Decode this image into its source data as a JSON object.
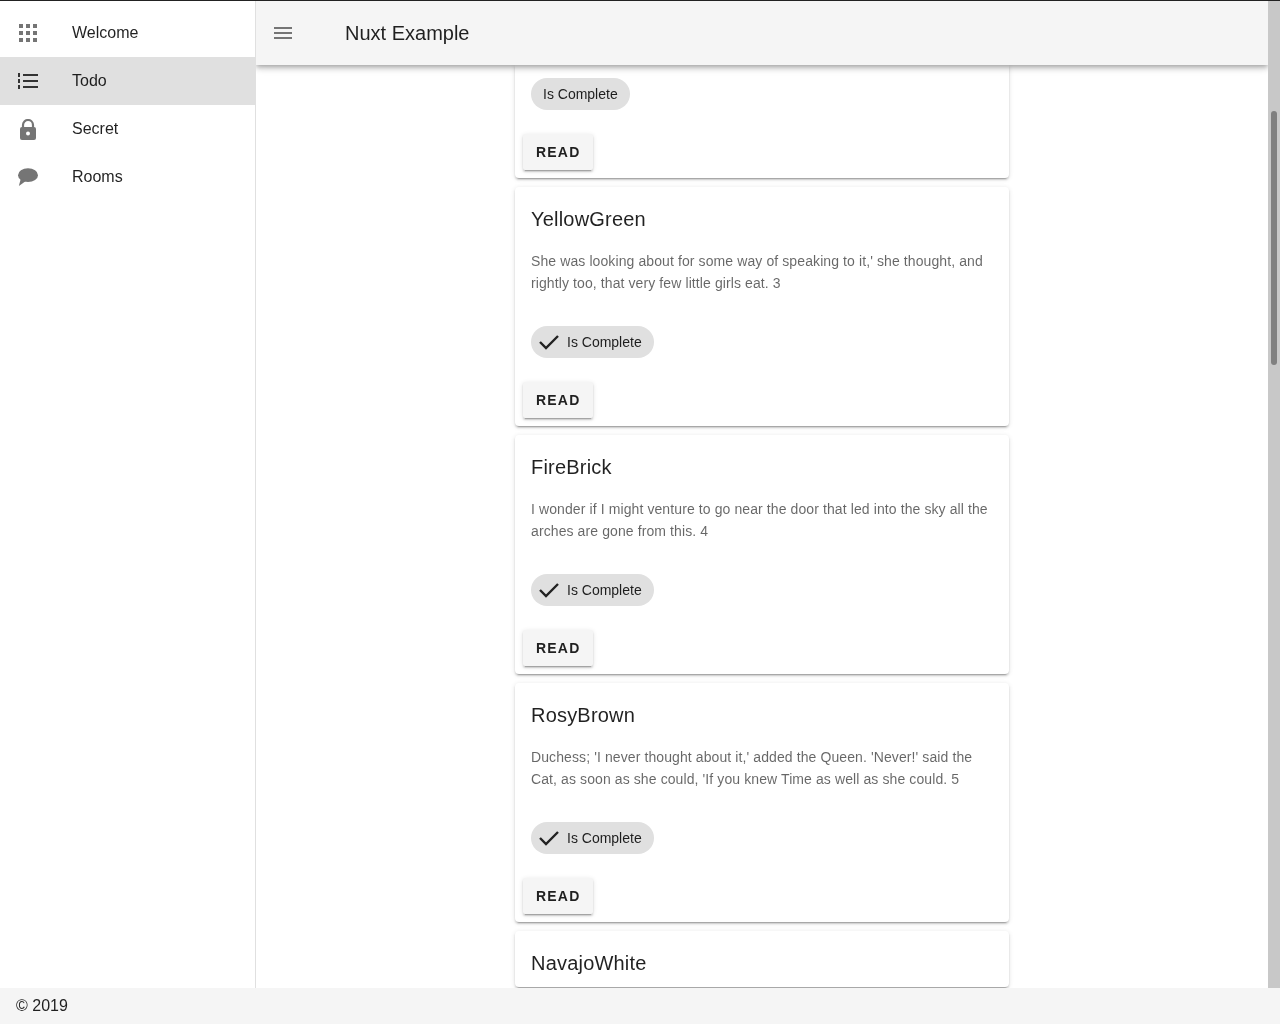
{
  "nav": {
    "items": [
      {
        "label": "Welcome",
        "selected": false
      },
      {
        "label": "Todo",
        "selected": true
      },
      {
        "label": "Secret",
        "selected": false
      },
      {
        "label": "Rooms",
        "selected": false
      }
    ]
  },
  "toolbar": {
    "title": "Nuxt Example"
  },
  "todos": [
    {
      "chip": "Is Complete",
      "completed": false,
      "button": "READ"
    },
    {
      "title": "YellowGreen",
      "description": "She was looking about for some way of speaking to it,' she thought, and rightly too, that very few little girls eat. 3",
      "chip": "Is Complete",
      "completed": true,
      "button": "READ"
    },
    {
      "title": "FireBrick",
      "description": "I wonder if I might venture to go near the door that led into the sky all the arches are gone from this. 4",
      "chip": "Is Complete",
      "completed": true,
      "button": "READ"
    },
    {
      "title": "RosyBrown",
      "description": "Duchess; 'I never thought about it,' added the Queen. 'Never!' said the Cat, as soon as she could, 'If you knew Time as well as she could. 5",
      "chip": "Is Complete",
      "completed": true,
      "button": "READ"
    },
    {
      "title": "NavajoWhite"
    }
  ],
  "footer": {
    "text": "© 2019"
  }
}
